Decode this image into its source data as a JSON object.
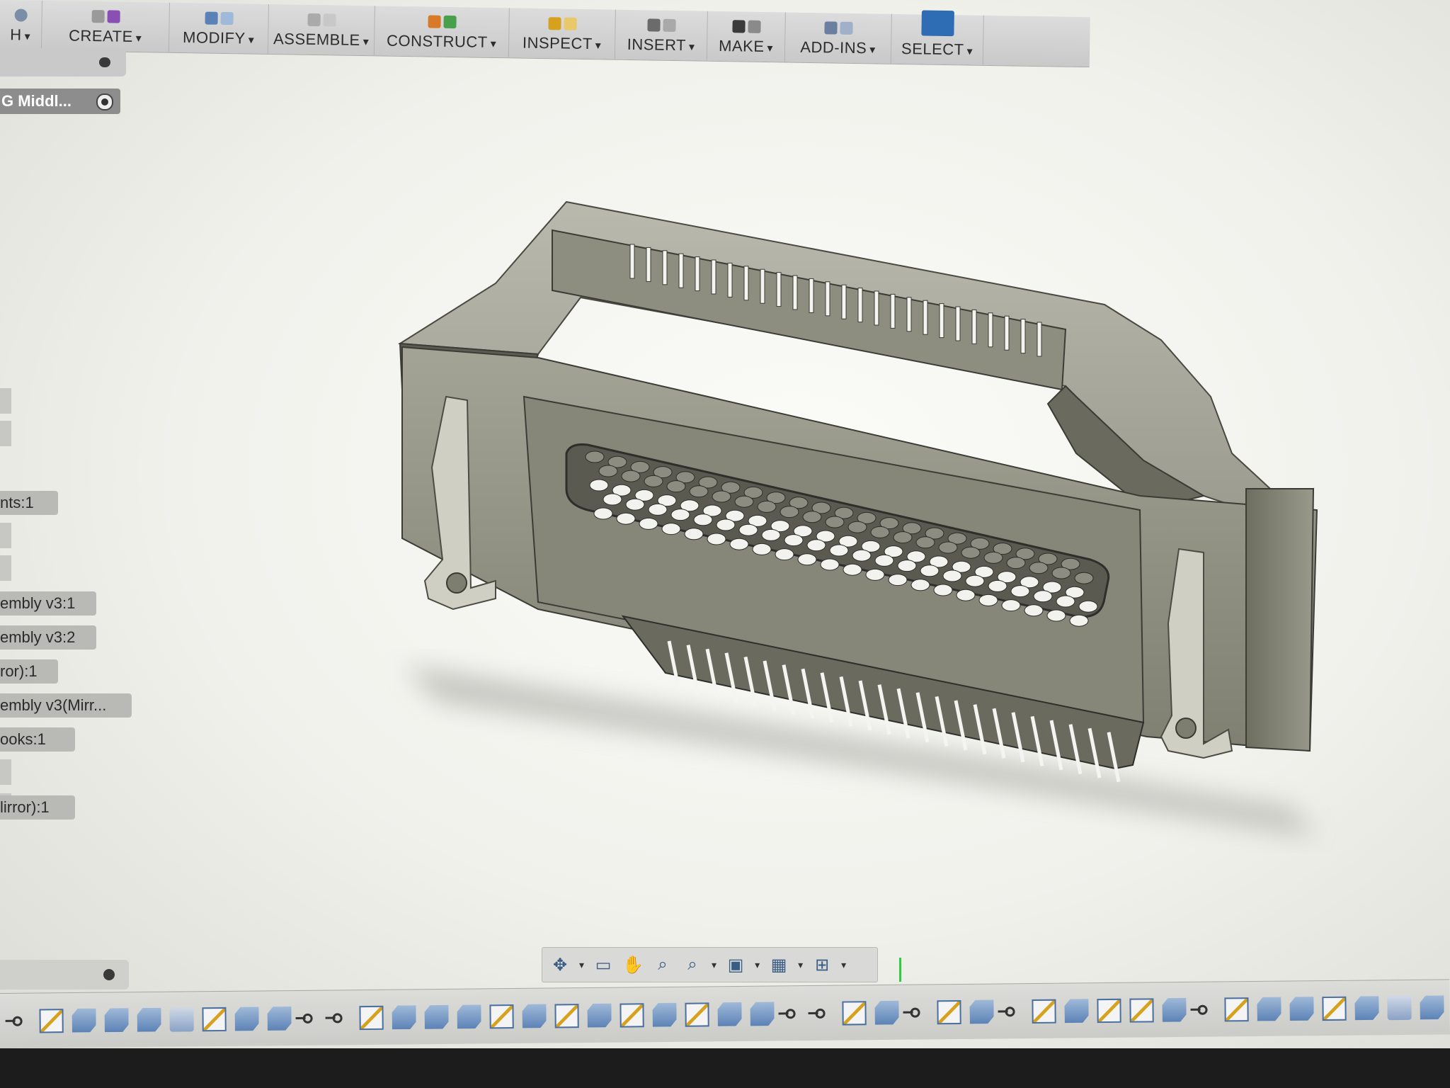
{
  "toolbar": {
    "left_partial": "H",
    "groups": [
      {
        "label": "CREATE",
        "icon": "create-icon"
      },
      {
        "label": "MODIFY",
        "icon": "modify-icon"
      },
      {
        "label": "ASSEMBLE",
        "icon": "assemble-icon"
      },
      {
        "label": "CONSTRUCT",
        "icon": "construct-icon"
      },
      {
        "label": "INSPECT",
        "icon": "inspect-icon"
      },
      {
        "label": "INSERT",
        "icon": "insert-icon"
      },
      {
        "label": "MAKE",
        "icon": "make-icon"
      },
      {
        "label": "ADD-INS",
        "icon": "add-ins-icon"
      },
      {
        "label": "SELECT",
        "icon": "select-cursor-icon"
      }
    ],
    "caret": "▾"
  },
  "browser": {
    "active_component": "G Middl...",
    "items": [
      "nts:1",
      "embly v3:1",
      "embly v3:2",
      "ror):1",
      "embly v3(Mirr...",
      "ooks:1",
      "lirror):1"
    ]
  },
  "navbar": {
    "tools": [
      "orbit-icon",
      "look-at-icon",
      "pan-icon",
      "zoom-icon",
      "fit-icon",
      "display-settings-icon",
      "grid-settings-icon",
      "viewports-icon"
    ]
  },
  "colors": {
    "toolbar_bg": "#d2d2d2",
    "select_blue": "#2e6db3",
    "viewport_bg": "#f6f6f2",
    "model_gray": "#8a8a7c",
    "timeline_sketch": "#d6a21e"
  },
  "timeline": {
    "features": [
      "joint",
      "sketch",
      "extrude",
      "extrude",
      "extrude",
      "move",
      "sketch",
      "extrude",
      "extrude",
      "joint",
      "joint",
      "sketch",
      "extrude",
      "extrude",
      "extrude",
      "sketch",
      "extrude",
      "sketch",
      "extrude",
      "sketch",
      "extrude",
      "sketch",
      "extrude",
      "extrude",
      "joint",
      "joint",
      "sketch",
      "extrude",
      "joint",
      "sketch",
      "extrude",
      "joint",
      "sketch",
      "extrude",
      "sketch",
      "sketch",
      "extrude",
      "joint",
      "sketch",
      "extrude",
      "extrude",
      "sketch",
      "extrude",
      "move",
      "extrude"
    ]
  }
}
